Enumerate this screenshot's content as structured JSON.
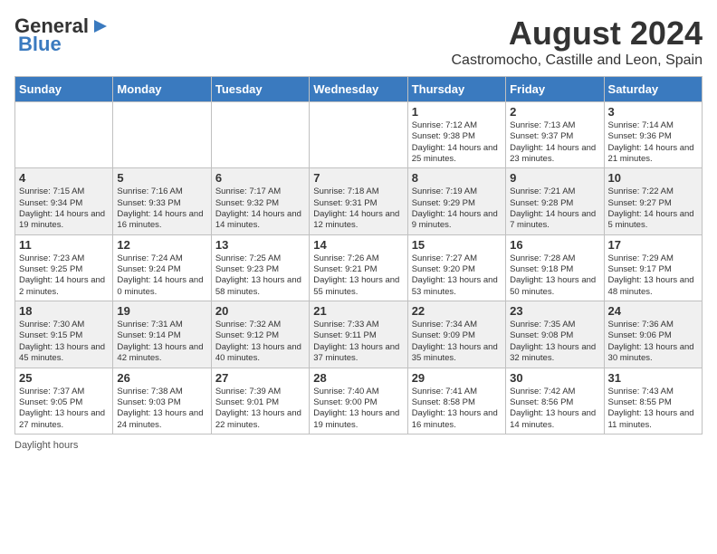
{
  "logo": {
    "text1": "General",
    "text2": "Blue"
  },
  "title": "August 2024",
  "subtitle": "Castromocho, Castille and Leon, Spain",
  "days": [
    "Sunday",
    "Monday",
    "Tuesday",
    "Wednesday",
    "Thursday",
    "Friday",
    "Saturday"
  ],
  "footer": "Daylight hours",
  "weeks": [
    [
      {
        "num": "",
        "info": ""
      },
      {
        "num": "",
        "info": ""
      },
      {
        "num": "",
        "info": ""
      },
      {
        "num": "",
        "info": ""
      },
      {
        "num": "1",
        "info": "Sunrise: 7:12 AM\nSunset: 9:38 PM\nDaylight: 14 hours and 25 minutes."
      },
      {
        "num": "2",
        "info": "Sunrise: 7:13 AM\nSunset: 9:37 PM\nDaylight: 14 hours and 23 minutes."
      },
      {
        "num": "3",
        "info": "Sunrise: 7:14 AM\nSunset: 9:36 PM\nDaylight: 14 hours and 21 minutes."
      }
    ],
    [
      {
        "num": "4",
        "info": "Sunrise: 7:15 AM\nSunset: 9:34 PM\nDaylight: 14 hours and 19 minutes."
      },
      {
        "num": "5",
        "info": "Sunrise: 7:16 AM\nSunset: 9:33 PM\nDaylight: 14 hours and 16 minutes."
      },
      {
        "num": "6",
        "info": "Sunrise: 7:17 AM\nSunset: 9:32 PM\nDaylight: 14 hours and 14 minutes."
      },
      {
        "num": "7",
        "info": "Sunrise: 7:18 AM\nSunset: 9:31 PM\nDaylight: 14 hours and 12 minutes."
      },
      {
        "num": "8",
        "info": "Sunrise: 7:19 AM\nSunset: 9:29 PM\nDaylight: 14 hours and 9 minutes."
      },
      {
        "num": "9",
        "info": "Sunrise: 7:21 AM\nSunset: 9:28 PM\nDaylight: 14 hours and 7 minutes."
      },
      {
        "num": "10",
        "info": "Sunrise: 7:22 AM\nSunset: 9:27 PM\nDaylight: 14 hours and 5 minutes."
      }
    ],
    [
      {
        "num": "11",
        "info": "Sunrise: 7:23 AM\nSunset: 9:25 PM\nDaylight: 14 hours and 2 minutes."
      },
      {
        "num": "12",
        "info": "Sunrise: 7:24 AM\nSunset: 9:24 PM\nDaylight: 14 hours and 0 minutes."
      },
      {
        "num": "13",
        "info": "Sunrise: 7:25 AM\nSunset: 9:23 PM\nDaylight: 13 hours and 58 minutes."
      },
      {
        "num": "14",
        "info": "Sunrise: 7:26 AM\nSunset: 9:21 PM\nDaylight: 13 hours and 55 minutes."
      },
      {
        "num": "15",
        "info": "Sunrise: 7:27 AM\nSunset: 9:20 PM\nDaylight: 13 hours and 53 minutes."
      },
      {
        "num": "16",
        "info": "Sunrise: 7:28 AM\nSunset: 9:18 PM\nDaylight: 13 hours and 50 minutes."
      },
      {
        "num": "17",
        "info": "Sunrise: 7:29 AM\nSunset: 9:17 PM\nDaylight: 13 hours and 48 minutes."
      }
    ],
    [
      {
        "num": "18",
        "info": "Sunrise: 7:30 AM\nSunset: 9:15 PM\nDaylight: 13 hours and 45 minutes."
      },
      {
        "num": "19",
        "info": "Sunrise: 7:31 AM\nSunset: 9:14 PM\nDaylight: 13 hours and 42 minutes."
      },
      {
        "num": "20",
        "info": "Sunrise: 7:32 AM\nSunset: 9:12 PM\nDaylight: 13 hours and 40 minutes."
      },
      {
        "num": "21",
        "info": "Sunrise: 7:33 AM\nSunset: 9:11 PM\nDaylight: 13 hours and 37 minutes."
      },
      {
        "num": "22",
        "info": "Sunrise: 7:34 AM\nSunset: 9:09 PM\nDaylight: 13 hours and 35 minutes."
      },
      {
        "num": "23",
        "info": "Sunrise: 7:35 AM\nSunset: 9:08 PM\nDaylight: 13 hours and 32 minutes."
      },
      {
        "num": "24",
        "info": "Sunrise: 7:36 AM\nSunset: 9:06 PM\nDaylight: 13 hours and 30 minutes."
      }
    ],
    [
      {
        "num": "25",
        "info": "Sunrise: 7:37 AM\nSunset: 9:05 PM\nDaylight: 13 hours and 27 minutes."
      },
      {
        "num": "26",
        "info": "Sunrise: 7:38 AM\nSunset: 9:03 PM\nDaylight: 13 hours and 24 minutes."
      },
      {
        "num": "27",
        "info": "Sunrise: 7:39 AM\nSunset: 9:01 PM\nDaylight: 13 hours and 22 minutes."
      },
      {
        "num": "28",
        "info": "Sunrise: 7:40 AM\nSunset: 9:00 PM\nDaylight: 13 hours and 19 minutes."
      },
      {
        "num": "29",
        "info": "Sunrise: 7:41 AM\nSunset: 8:58 PM\nDaylight: 13 hours and 16 minutes."
      },
      {
        "num": "30",
        "info": "Sunrise: 7:42 AM\nSunset: 8:56 PM\nDaylight: 13 hours and 14 minutes."
      },
      {
        "num": "31",
        "info": "Sunrise: 7:43 AM\nSunset: 8:55 PM\nDaylight: 13 hours and 11 minutes."
      }
    ]
  ]
}
